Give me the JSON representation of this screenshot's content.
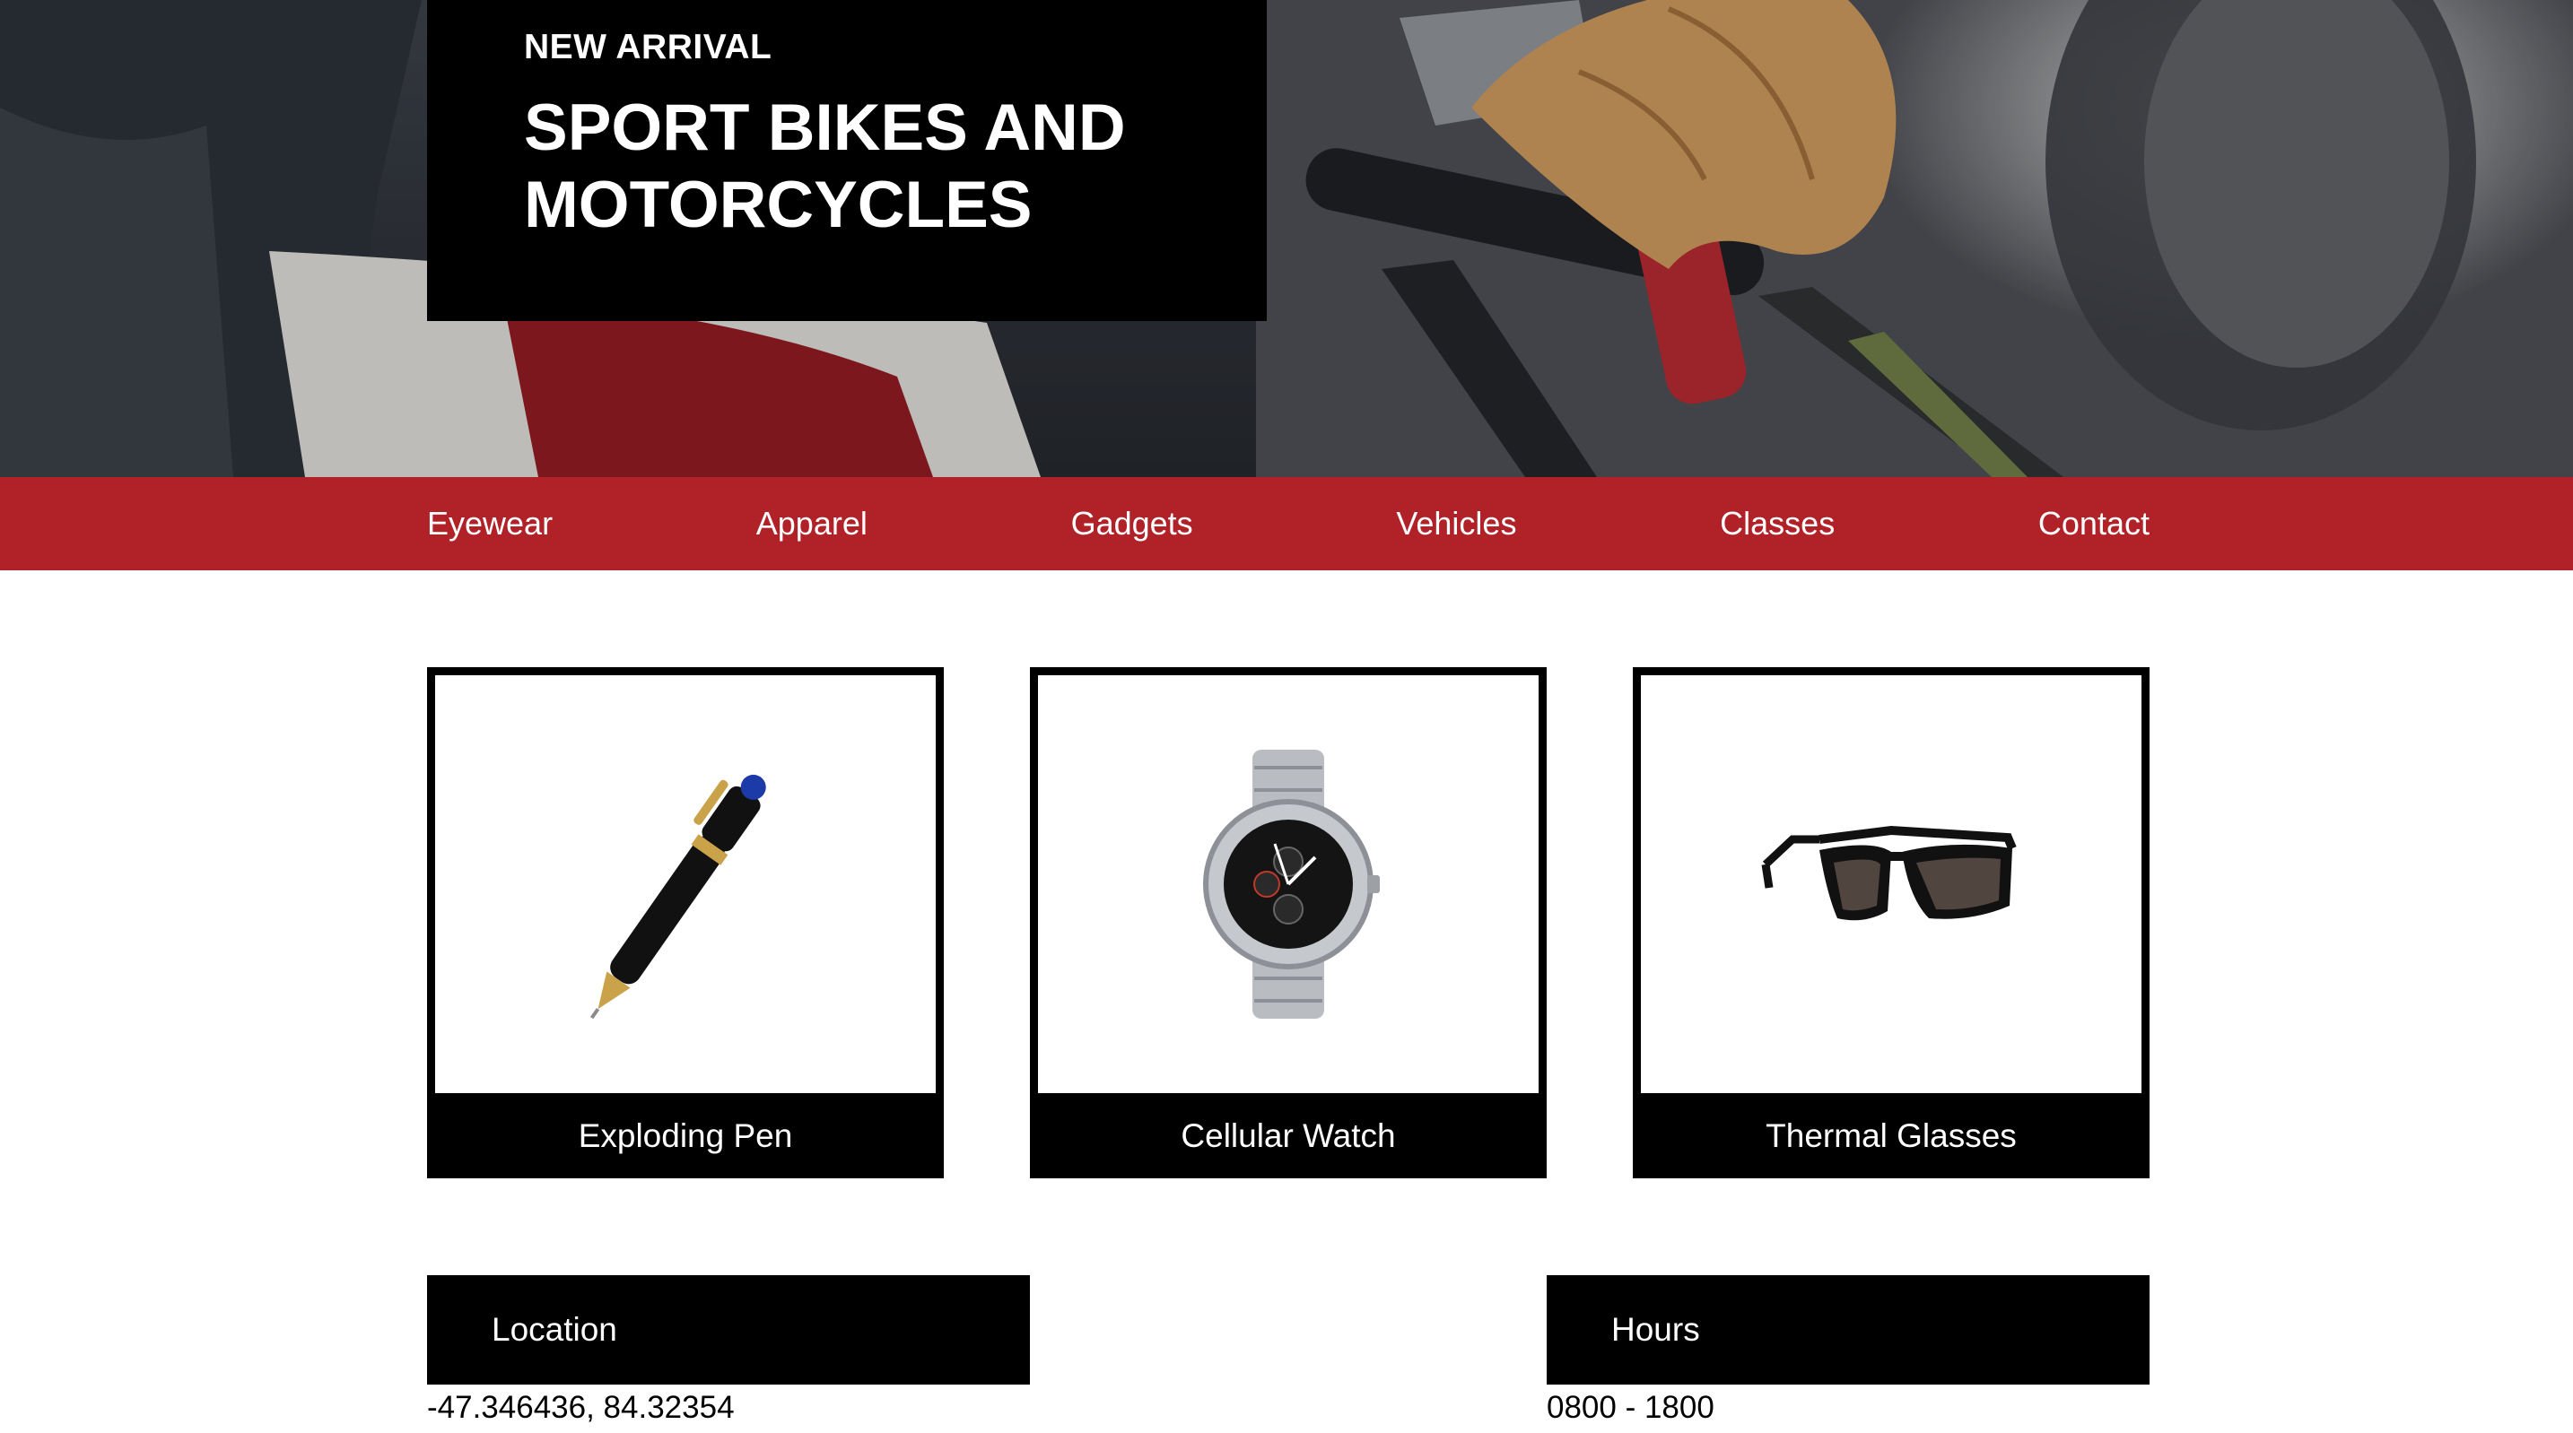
{
  "hero": {
    "kicker": "NEW ARRIVAL",
    "headline": "SPORT BIKES AND MOTORCYCLES"
  },
  "nav": {
    "items": [
      "Eyewear",
      "Apparel",
      "Gadgets",
      "Vehicles",
      "Classes",
      "Contact"
    ]
  },
  "products": [
    {
      "name": "Exploding Pen",
      "icon": "pen-image"
    },
    {
      "name": "Cellular Watch",
      "icon": "watch-image"
    },
    {
      "name": "Thermal Glasses",
      "icon": "glasses-image"
    }
  ],
  "info": {
    "location_label": "Location",
    "location_value": "-47.346436, 84.32354",
    "hours_label": "Hours",
    "hours_value": "0800 - 1800"
  },
  "colors": {
    "nav_red": "#b12228",
    "black": "#000000",
    "white": "#ffffff"
  }
}
